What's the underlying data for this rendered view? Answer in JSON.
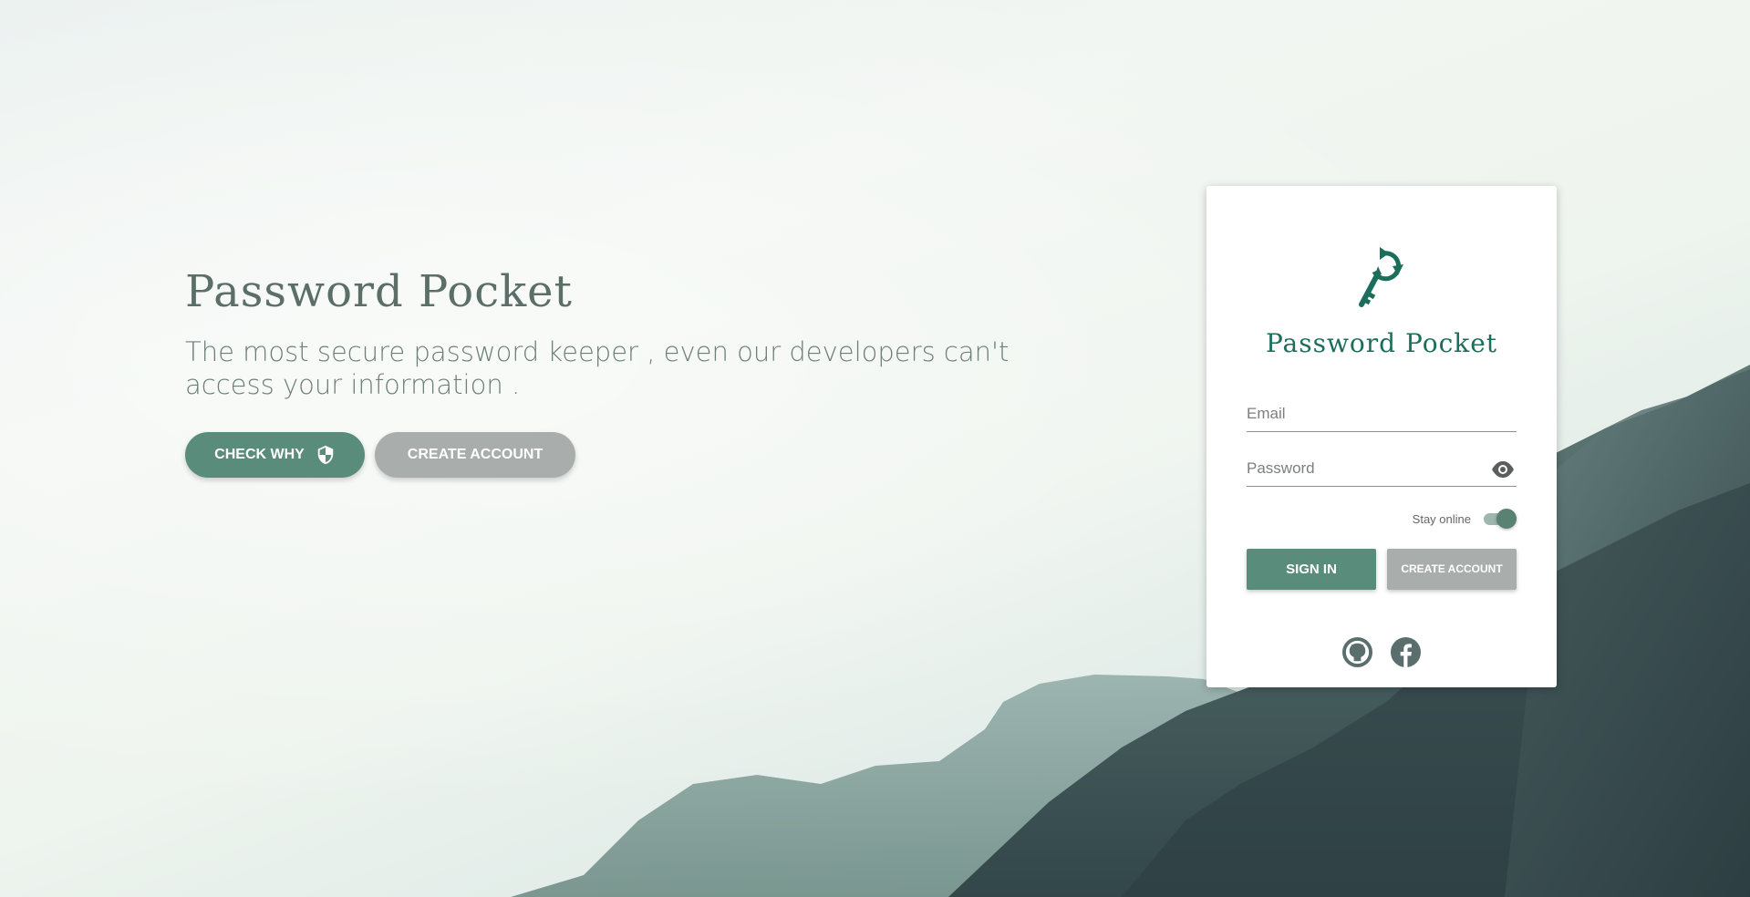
{
  "brand": {
    "name": "Password Pocket",
    "tagline": "The most secure password keeper , even our developers can't access your information ."
  },
  "hero": {
    "check_why_label": "CHECK WHY",
    "create_account_label": "CREATE ACCOUNT",
    "check_why_icon": "shield-icon"
  },
  "login": {
    "title": "Password Pocket",
    "logo_icon": "key-refresh-icon",
    "email_placeholder": "Email",
    "password_placeholder": "Password",
    "password_toggle_icon": "eye-icon",
    "stay_online_label": "Stay online",
    "stay_online_enabled": true,
    "sign_in_label": "SIGN IN",
    "create_account_label": "CREATE ACCOUNT",
    "social": [
      {
        "name": "github-icon"
      },
      {
        "name": "facebook-icon"
      }
    ]
  },
  "colors": {
    "primary": "#5a8c7c",
    "secondary": "#a9adab",
    "brand_text": "#1c6e5c",
    "hero_title": "#5b6e68"
  }
}
